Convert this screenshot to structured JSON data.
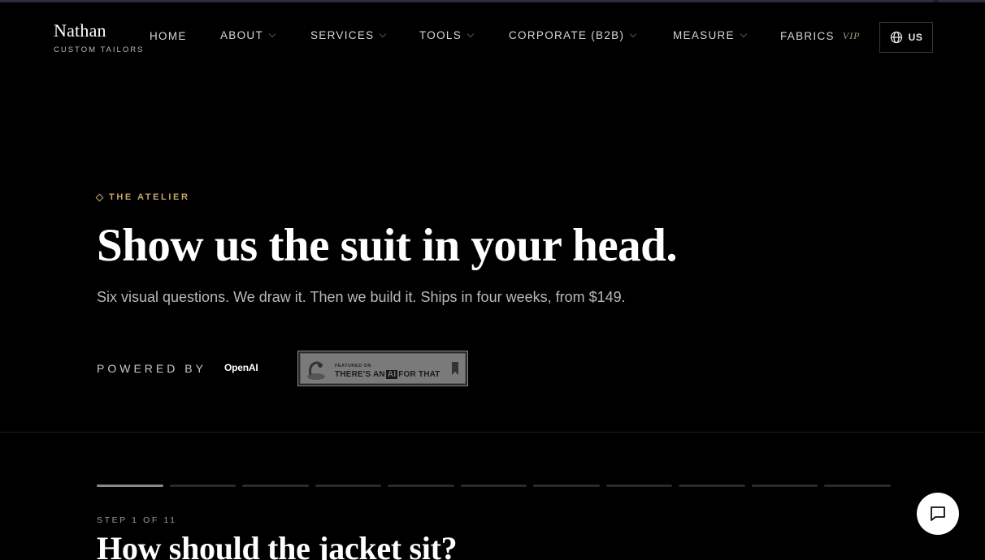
{
  "brand": {
    "name": "Nathan",
    "subtitle": "CUSTOM TAILORS"
  },
  "nav": {
    "items": [
      {
        "label": "HOME",
        "has_dropdown": false
      },
      {
        "label": "ABOUT",
        "has_dropdown": true
      },
      {
        "label": "SERVICES",
        "has_dropdown": true
      },
      {
        "label": "TOOLS",
        "has_dropdown": true
      },
      {
        "label": "CORPORATE (B2B)",
        "has_dropdown": true
      },
      {
        "label": "MEASURE",
        "has_dropdown": true
      },
      {
        "label": "FABRICS",
        "badge": "VIP",
        "has_dropdown": false
      }
    ],
    "locale": {
      "label": "US",
      "icon": "globe-icon"
    }
  },
  "hero": {
    "eyebrow": "THE ATELIER",
    "title": "Show us the suit in your head.",
    "subtitle": "Six visual questions. We draw it. Then we build it. Ships in four weeks, from $149.",
    "powered_by_label": "POWERED BY",
    "powered_by_partner": "OpenAI",
    "badge": {
      "small_text": "FEATURED ON",
      "text_before": "THERE'S AN",
      "text_highlight": "AI",
      "text_after": "FOR THAT"
    }
  },
  "wizard": {
    "total_steps": 11,
    "current_step": 1,
    "step_label": "STEP 1 OF 11",
    "question": "How should the jacket sit?"
  },
  "chat": {
    "icon": "chat-bubble-icon"
  },
  "colors": {
    "background": "#000000",
    "accent_gold": "#c9a76a",
    "text_primary": "#ffffff",
    "text_muted": "#b9b9b9"
  }
}
